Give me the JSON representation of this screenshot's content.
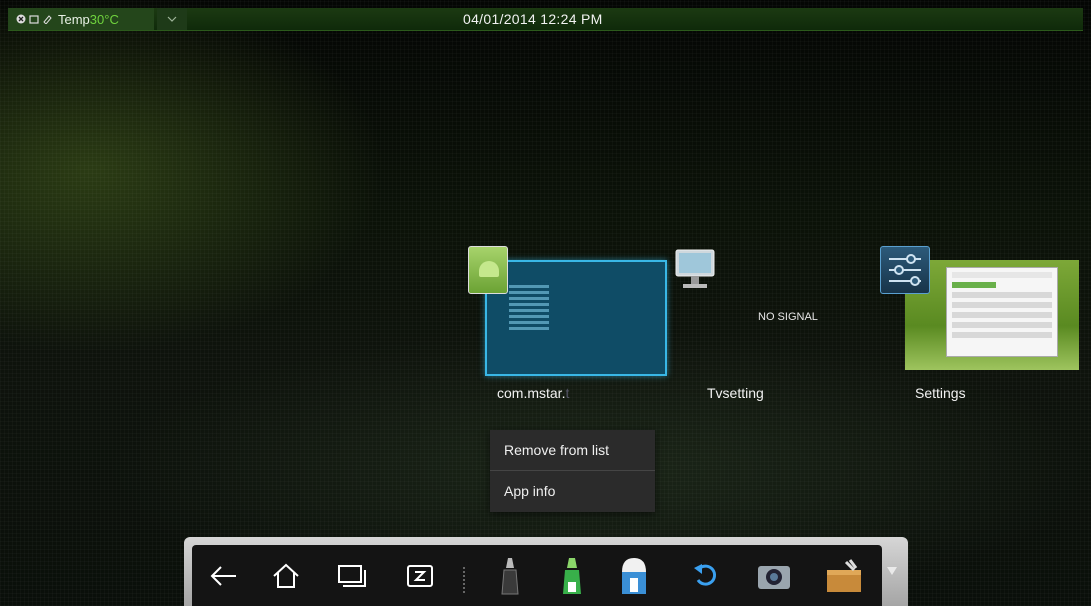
{
  "status_bar": {
    "temp_label": "Temp",
    "temp_value": "30°C",
    "datetime": "04/01/2014 12:24 PM"
  },
  "recent_apps": [
    {
      "label": "com.mstar.t",
      "label_visible": "com.mstar.",
      "label_faded": "t"
    },
    {
      "label": "Tvsetting",
      "thumb_text": "NO SIGNAL"
    },
    {
      "label": "Settings"
    }
  ],
  "context_menu": {
    "items": [
      "Remove from list",
      "App info"
    ]
  },
  "dock": {
    "icons": [
      "back-arrow-icon",
      "home-icon",
      "recent-apps-icon",
      "sleep-icon",
      "pen-black-icon",
      "pen-green-icon",
      "eraser-icon",
      "undo-icon",
      "camera-icon",
      "toolbox-icon"
    ]
  },
  "colors": {
    "accent": "#39b7e6",
    "temp": "#6fd23d"
  }
}
